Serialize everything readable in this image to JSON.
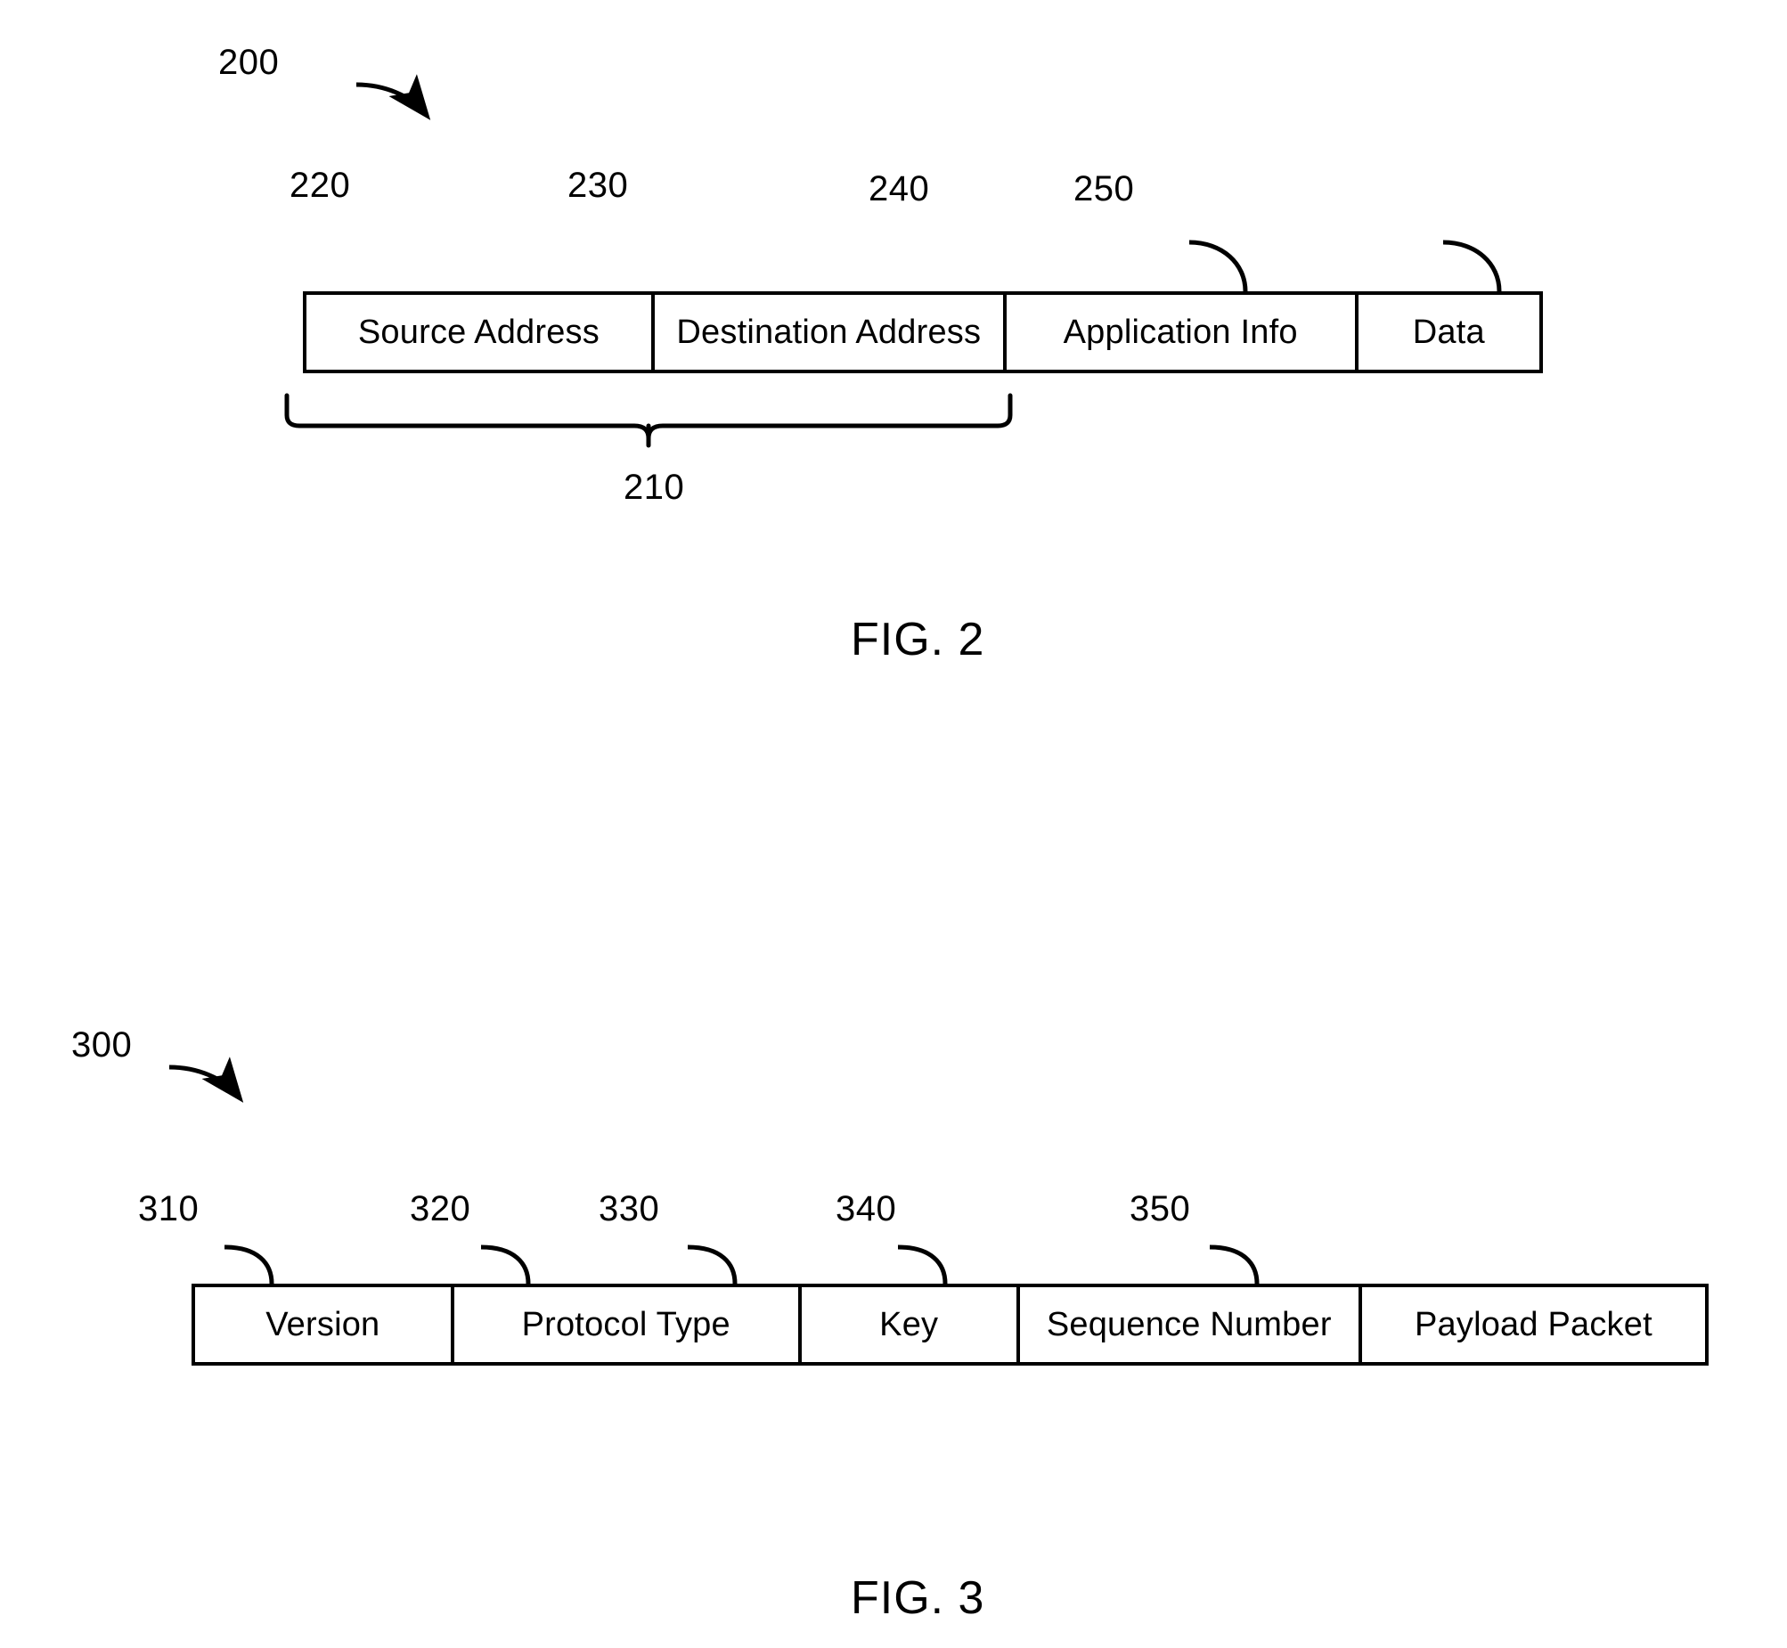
{
  "document": {
    "type": "patent-drawing-sheet",
    "figures": [
      {
        "id": "fig2",
        "caption": "FIG. 2",
        "assembly_ref": "200",
        "packet": {
          "fields": [
            {
              "ref": "220",
              "label": "Source Address"
            },
            {
              "ref": "230",
              "label": "Destination Address"
            },
            {
              "ref": "240",
              "label": "Application Info"
            },
            {
              "ref": "250",
              "label": "Data"
            }
          ],
          "group_brace": {
            "ref": "210",
            "spans": [
              "Source Address",
              "Destination Address"
            ]
          }
        }
      },
      {
        "id": "fig3",
        "caption": "FIG. 3",
        "assembly_ref": "300",
        "packet": {
          "fields": [
            {
              "ref": "310",
              "label": "Version"
            },
            {
              "ref": "320",
              "label": "Protocol Type"
            },
            {
              "ref": "330",
              "label": "Key"
            },
            {
              "ref": "340",
              "label": "Sequence Number"
            },
            {
              "ref": "350",
              "label": "Payload Packet"
            }
          ]
        }
      }
    ]
  },
  "colors": {
    "ink": "#000000",
    "paper": "#ffffff"
  }
}
